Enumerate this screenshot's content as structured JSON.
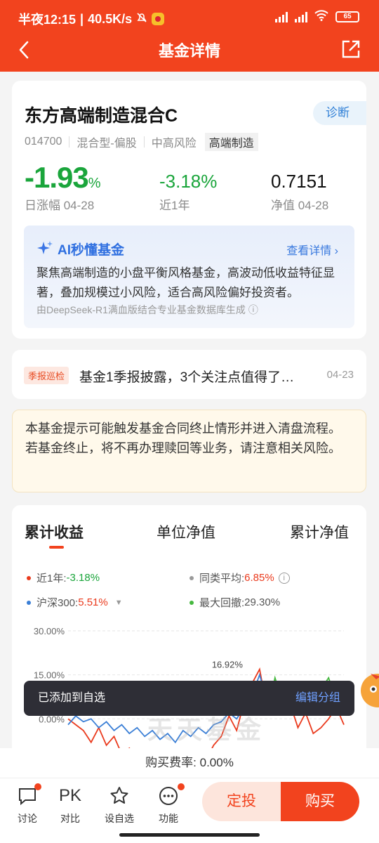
{
  "status": {
    "time": "半夜12:15",
    "speed": "40.5K/s",
    "battery": "65",
    "sim1": "HD",
    "sim2": "HD"
  },
  "header": {
    "title": "基金详情"
  },
  "fund": {
    "name": "东方高端制造混合C",
    "diagnose_label": "诊断",
    "code": "014700",
    "type": "混合型-偏股",
    "risk": "中高风险",
    "theme": "高端制造",
    "day_change": "-1.93",
    "day_change_unit": "%",
    "day_change_label": "日涨幅 04-28",
    "year_change": "-3.18%",
    "year_change_label": "近1年",
    "nav": "0.7151",
    "nav_label": "净值 04-28"
  },
  "ai": {
    "title": "AI秒懂基金",
    "more": "查看详情 ›",
    "text": "聚焦高端制造的小盘平衡风格基金，高波动低收益特征显著，叠加规模过小风险，适合高风险偏好投资者。",
    "source": "由DeepSeek-R1满血版结合专业基金数据库生成 ⓘ"
  },
  "news": {
    "tag": "季报巡检",
    "text": "基金1季报披露，3个关注点值得了…",
    "date": "04-23"
  },
  "notice": "本基金提示可能触发基金合同终止情形并进入清盘流程。若基金终止，将不再办理赎回等业务，请注意相关风险。",
  "tabs": [
    "累计收益",
    "单位净值",
    "累计净值"
  ],
  "legend": {
    "year_label": "近1年:",
    "year_value": "-3.18%",
    "peer_label": "同类平均:",
    "peer_value": "6.85%",
    "hs_label": "沪深300:",
    "hs_value": "5.51%",
    "dd_label": "最大回撤:",
    "dd_value": "29.30%"
  },
  "colors": {
    "fund": "#ea3a1d",
    "peer": "#9a9a9a",
    "hs300": "#3b7fd6",
    "drawdown": "#45b83f",
    "brand": "#f2431e"
  },
  "chart_data": {
    "type": "line",
    "yticks": [
      "30.00%",
      "15.00%",
      "0.00%"
    ],
    "ylim": [
      -10,
      30
    ],
    "peak_label": "16.92%",
    "series": [
      {
        "name": "近1年",
        "values": [
          0,
          -2,
          -4,
          -8,
          -3,
          -9,
          -6,
          -12,
          -10,
          -13,
          -11,
          -15,
          -12,
          -14,
          -16,
          -13,
          -15,
          -11,
          -14,
          -9,
          -6,
          1,
          -4,
          6,
          12,
          16.9,
          3,
          10,
          2,
          5,
          -3,
          2,
          -5,
          -3,
          0,
          4,
          -2
        ]
      },
      {
        "name": "沪深300",
        "values": [
          -2,
          1,
          -1,
          0,
          -3,
          -1,
          -4,
          -2,
          -5,
          -3,
          -6,
          -4,
          -7,
          -5,
          -8,
          -4,
          -6,
          -3,
          -5,
          -2,
          -1,
          2,
          0,
          4,
          8,
          15,
          6,
          10,
          5,
          9,
          3,
          7,
          5,
          9,
          12,
          8,
          5
        ]
      },
      {
        "name": "最大回撤",
        "values": [
          null,
          null,
          null,
          null,
          null,
          null,
          null,
          null,
          null,
          null,
          null,
          null,
          null,
          null,
          null,
          null,
          null,
          null,
          null,
          null,
          null,
          null,
          null,
          null,
          null,
          8,
          2,
          14,
          6,
          11,
          3,
          8,
          4,
          10,
          14,
          6,
          3
        ]
      }
    ]
  },
  "toast": {
    "text": "已添加到自选",
    "action": "编辑分组"
  },
  "watermark": "天天基金",
  "fee": "购买费率:  0.00%",
  "bottom": {
    "discuss": "讨论",
    "pk_icon": "PK",
    "compare": "对比",
    "watch": "设自选",
    "func": "功能",
    "sip": "定投",
    "buy": "购买"
  }
}
